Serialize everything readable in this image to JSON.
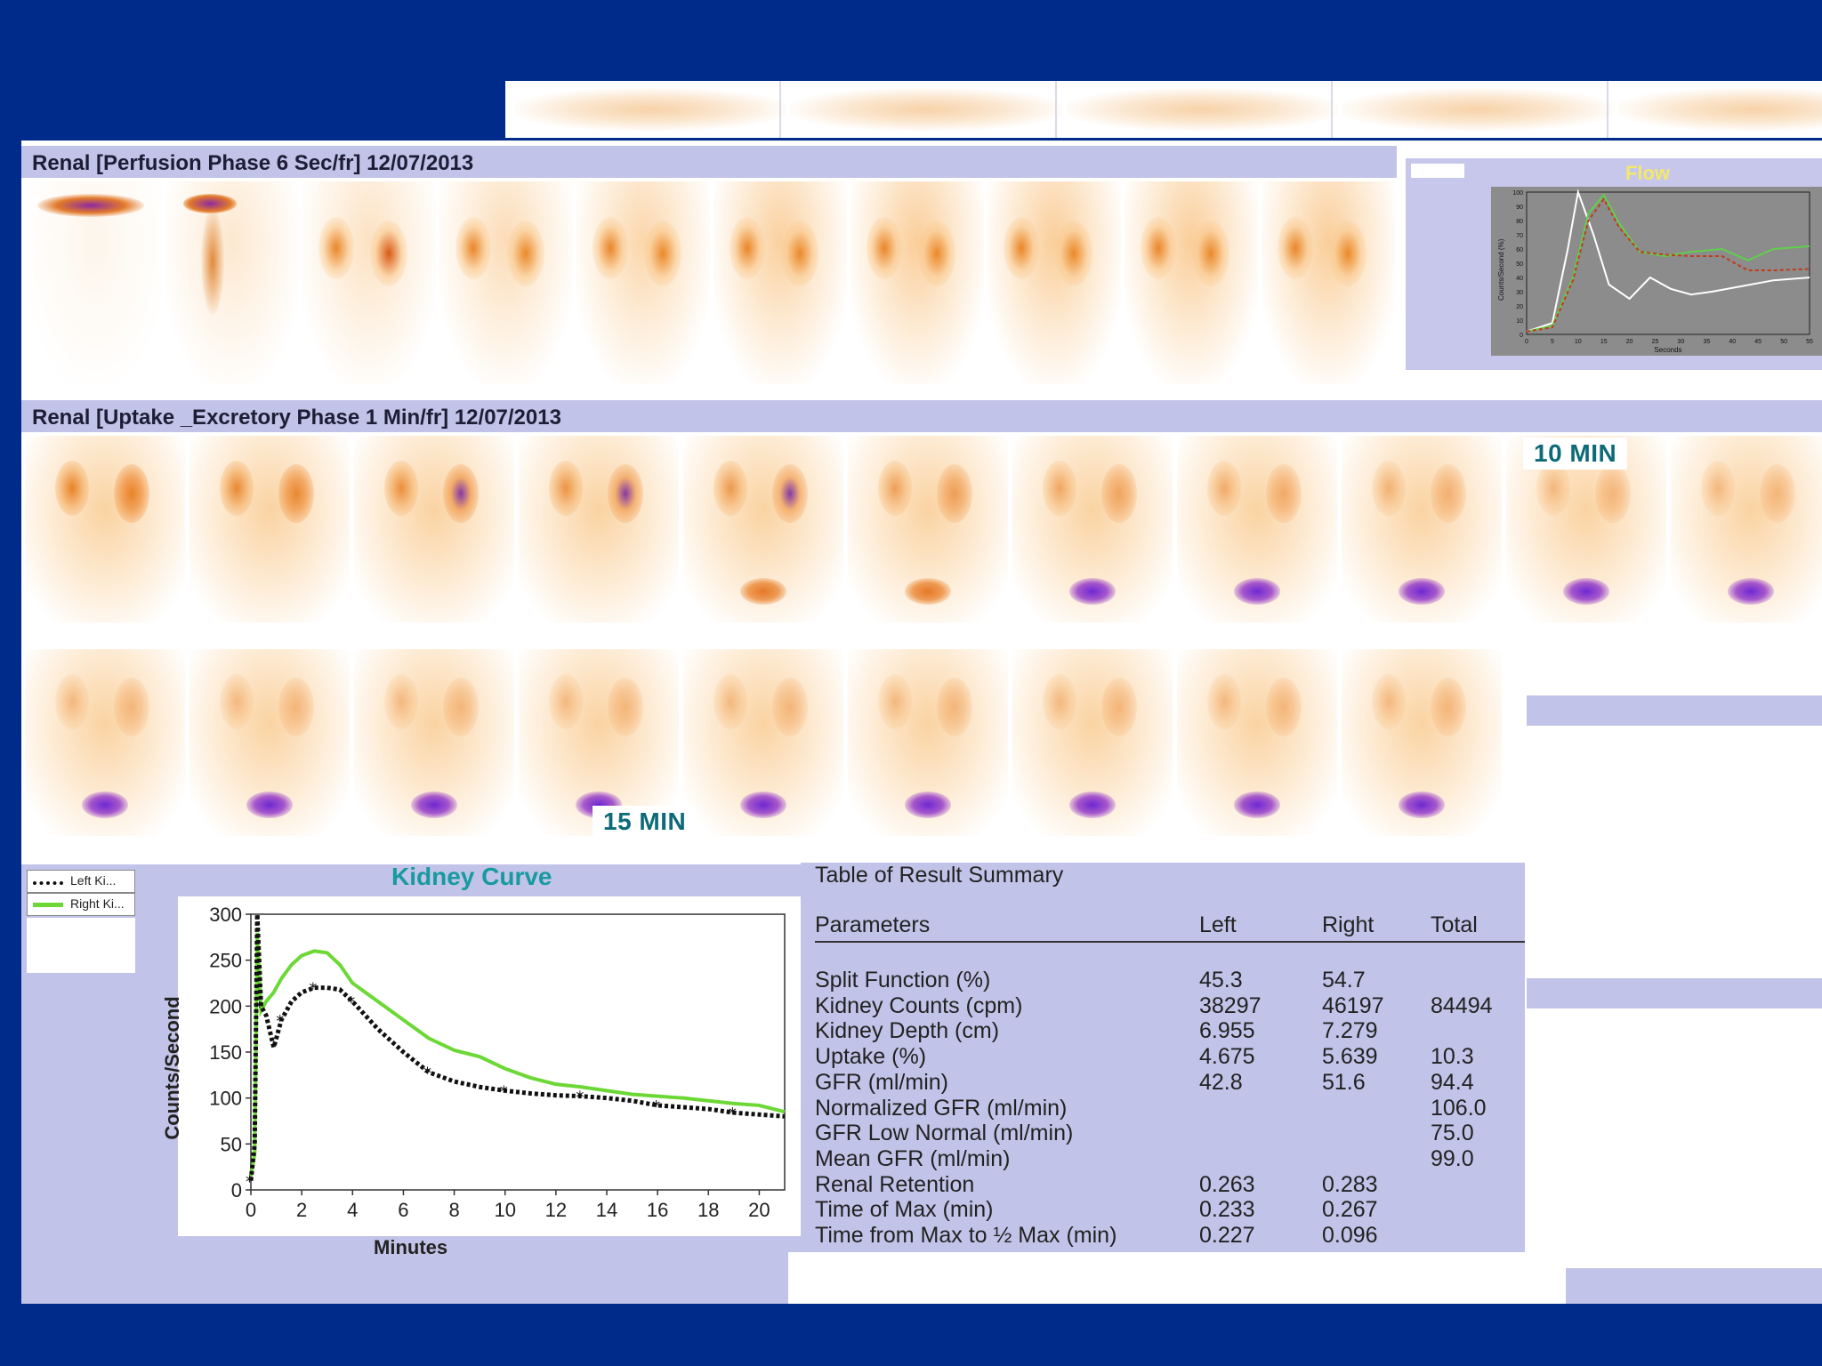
{
  "perfusion": {
    "title": "Renal [Perfusion Phase 6 Sec/fr] 12/07/2013"
  },
  "uptake": {
    "title": "Renal [Uptake _Excretory Phase 1 Min/fr] 12/07/2013",
    "marker_10": "10 MIN",
    "marker_15": "15 MIN"
  },
  "flow_chart": {
    "title": "Flow",
    "ylabel": "Counts/Second (%)",
    "xlabel": "Seconds",
    "colors": {
      "white": "#ffffff",
      "green": "#5fd04a",
      "red": "#c23a1a"
    },
    "x_ticks": [
      "0",
      "5",
      "10",
      "15",
      "20",
      "25",
      "30",
      "35",
      "40",
      "45",
      "50",
      "55"
    ],
    "y_ticks": [
      "0",
      "10",
      "20",
      "30",
      "40",
      "50",
      "60",
      "70",
      "80",
      "90",
      "100"
    ]
  },
  "legend": {
    "left_label": "Left Ki...",
    "right_label": "Right Ki..."
  },
  "chart_data": {
    "type": "line",
    "title": "Kidney Curve",
    "xlabel": "Minutes",
    "ylabel": "Counts/Second",
    "xlim": [
      0,
      21
    ],
    "ylim": [
      0,
      300
    ],
    "x_ticks": [
      0,
      2,
      4,
      6,
      8,
      10,
      12,
      14,
      16,
      18,
      20
    ],
    "y_ticks": [
      0,
      50,
      100,
      150,
      200,
      250,
      300
    ],
    "series": [
      {
        "name": "Left Ki...",
        "color": "#111111",
        "style": "dotted",
        "x": [
          0,
          0.15,
          0.25,
          0.4,
          0.6,
          0.9,
          1.2,
          1.6,
          2.0,
          2.5,
          3.0,
          3.5,
          4.0,
          5.0,
          6.0,
          7.0,
          8.0,
          9.0,
          10.0,
          11.0,
          12.0,
          13.0,
          14.0,
          15.0,
          16.0,
          17.0,
          18.0,
          19.0,
          20.0,
          21.0
        ],
        "values": [
          10,
          50,
          300,
          200,
          190,
          155,
          185,
          205,
          215,
          220,
          220,
          218,
          205,
          175,
          150,
          128,
          118,
          112,
          108,
          105,
          103,
          102,
          100,
          97,
          92,
          90,
          88,
          84,
          82,
          80
        ]
      },
      {
        "name": "Right Ki...",
        "color": "#6cd836",
        "style": "solid",
        "x": [
          0,
          0.15,
          0.25,
          0.4,
          0.6,
          0.9,
          1.2,
          1.6,
          2.0,
          2.5,
          3.0,
          3.5,
          4.0,
          5.0,
          6.0,
          7.0,
          8.0,
          9.0,
          10.0,
          11.0,
          12.0,
          13.0,
          14.0,
          15.0,
          16.0,
          17.0,
          18.0,
          19.0,
          20.0,
          21.0
        ],
        "values": [
          15,
          40,
          280,
          195,
          205,
          215,
          230,
          245,
          255,
          260,
          258,
          245,
          225,
          205,
          185,
          165,
          152,
          145,
          132,
          122,
          115,
          112,
          108,
          104,
          102,
          100,
          97,
          94,
          92,
          85
        ]
      }
    ]
  },
  "summary": {
    "title": "Table of Result Summary",
    "headers": [
      "Parameters",
      "Left",
      "Right",
      "Total"
    ],
    "rows": [
      [
        "Split Function (%)",
        "45.3",
        "54.7",
        ""
      ],
      [
        "Kidney Counts (cpm)",
        "38297",
        "46197",
        "84494"
      ],
      [
        "Kidney Depth (cm)",
        "6.955",
        "7.279",
        ""
      ],
      [
        "Uptake (%)",
        "4.675",
        "5.639",
        "10.3"
      ],
      [
        "GFR (ml/min)",
        "42.8",
        "51.6",
        "94.4"
      ],
      [
        "Normalized GFR (ml/min)",
        "",
        "",
        "106.0"
      ],
      [
        "GFR Low Normal (ml/min)",
        "",
        "",
        "75.0"
      ],
      [
        "Mean GFR (ml/min)",
        "",
        "",
        "99.0"
      ],
      [
        "Renal Retention",
        "0.263",
        "0.283",
        ""
      ],
      [
        "Time of Max (min)",
        "0.233",
        "0.267",
        ""
      ],
      [
        "Time from Max to ½ Max (min)",
        "0.227",
        "0.096",
        ""
      ]
    ]
  }
}
